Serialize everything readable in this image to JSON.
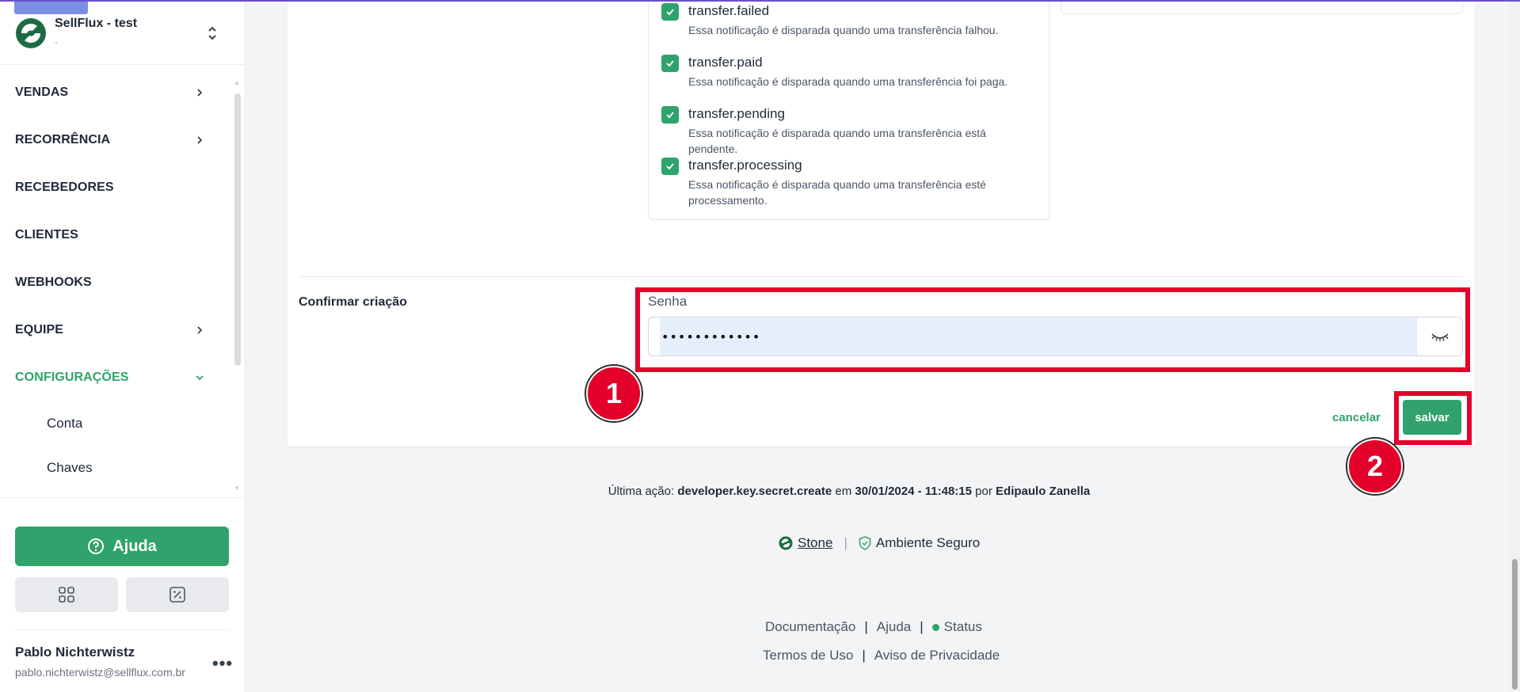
{
  "org": {
    "name": "SellFlux - test",
    "subtitle": "-"
  },
  "nav": {
    "items": [
      {
        "label": "VENDAS",
        "has_chevron": true
      },
      {
        "label": "RECORRÊNCIA",
        "has_chevron": true
      },
      {
        "label": "RECEBEDORES",
        "has_chevron": false
      },
      {
        "label": "CLIENTES",
        "has_chevron": false
      },
      {
        "label": "WEBHOOKS",
        "has_chevron": false
      },
      {
        "label": "EQUIPE",
        "has_chevron": true
      },
      {
        "label": "CONFIGURAÇÕES",
        "has_chevron": true,
        "active": true
      }
    ],
    "sub_items": [
      "Conta",
      "Chaves"
    ]
  },
  "help": {
    "label": "Ajuda"
  },
  "user": {
    "name": "Pablo Nichterwistz",
    "email": "pablo.nichterwistz@sellflux.com.br"
  },
  "events": [
    {
      "name": "transfer.failed",
      "desc": "Essa notificação é disparada quando uma transferência falhou."
    },
    {
      "name": "transfer.paid",
      "desc": "Essa notificação é disparada quando uma transferência foi paga."
    },
    {
      "name": "transfer.pending",
      "desc": "Essa notificação é disparada quando uma transferência está pendente."
    },
    {
      "name": "transfer.processing",
      "desc": "Essa notificação é disparada quando uma transferência esté processamento."
    }
  ],
  "confirm": {
    "label": "Confirmar criação",
    "password_label": "Senha",
    "password_value": "••••••••••••"
  },
  "actions": {
    "cancel": "cancelar",
    "save": "salvar"
  },
  "annotations": {
    "badge1": "1",
    "badge2": "2"
  },
  "last_action": {
    "prefix": "Última ação:",
    "action": "developer.key.secret.create",
    "em": "em",
    "when": "30/01/2024 - 11:48:15",
    "por": "por",
    "who": "Edipaulo Zanella"
  },
  "security": {
    "brand": "Stone",
    "label": "Ambiente Seguro"
  },
  "footer": {
    "docs": "Documentação",
    "help": "Ajuda",
    "status": "Status",
    "terms": "Termos de Uso",
    "privacy": "Aviso de Privacidade"
  },
  "colors": {
    "brand_green": "#2fa36b",
    "highlight_red": "#e3002b",
    "accent_purple": "#6b4fc9"
  }
}
